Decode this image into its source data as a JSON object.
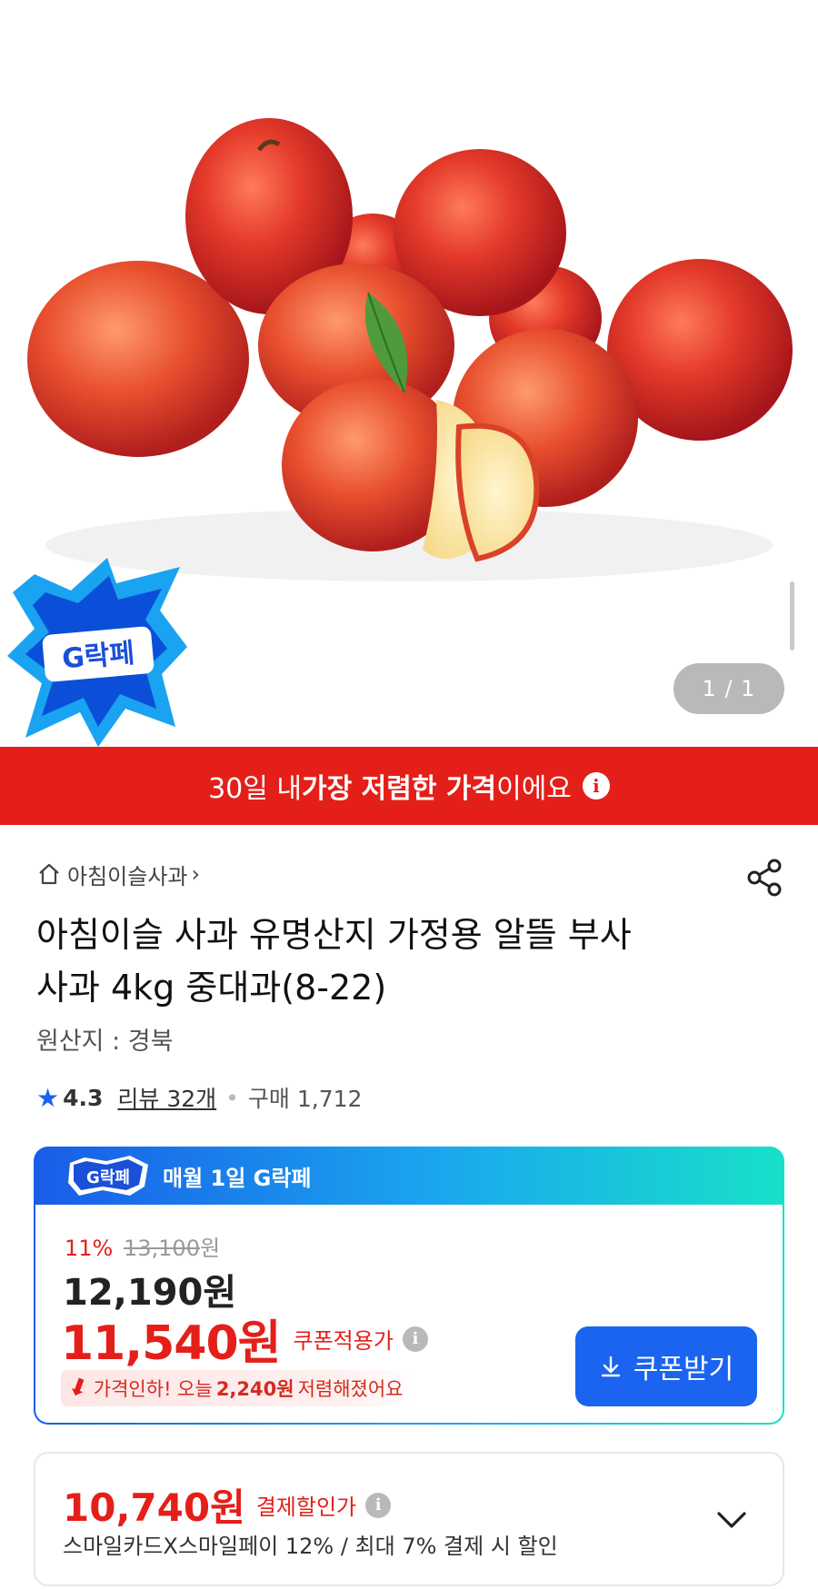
{
  "hero": {
    "pager": "1 / 1",
    "badge_text": "G락페",
    "image_icon": "apples-photo"
  },
  "promo": {
    "prefix": "30일 내 ",
    "bold": "가장 저렴한 가격",
    "suffix": "이에요",
    "info_icon": "info-icon"
  },
  "shop": {
    "name": "아침이슬사과",
    "chevron": "›"
  },
  "product": {
    "title_line1": "아침이슬 사과 유명산지 가정용 알뜰 부사",
    "title_line2": "사과 4kg 중대과(8-22)",
    "origin": "원산지 : 경북"
  },
  "rating": {
    "score": "4.3",
    "review": "리뷰 32개",
    "purchase": "구매 1,712"
  },
  "deal_card": {
    "badge": "G락페",
    "header": "매월 1일 G락페",
    "discount_pct": "11%",
    "original_price": "13,100",
    "original_unit": "원",
    "sale_price": "12,190",
    "sale_unit": "원",
    "coupon_price": "11,540원",
    "coupon_label": "쿠폰적용가",
    "drop_prefix": "가격인하! 오늘",
    "drop_amount": "2,240원",
    "drop_suffix": "저렴해졌어요",
    "coupon_button": "쿠폰받기"
  },
  "payment": {
    "price": "10,740원",
    "label": "결제할인가",
    "desc": "스마일카드X스마일페이 12% / 최대 7% 결제 시 할인"
  },
  "colors": {
    "red": "#e41f19",
    "blue": "#1a64f0",
    "teal": "#18e0c8"
  }
}
